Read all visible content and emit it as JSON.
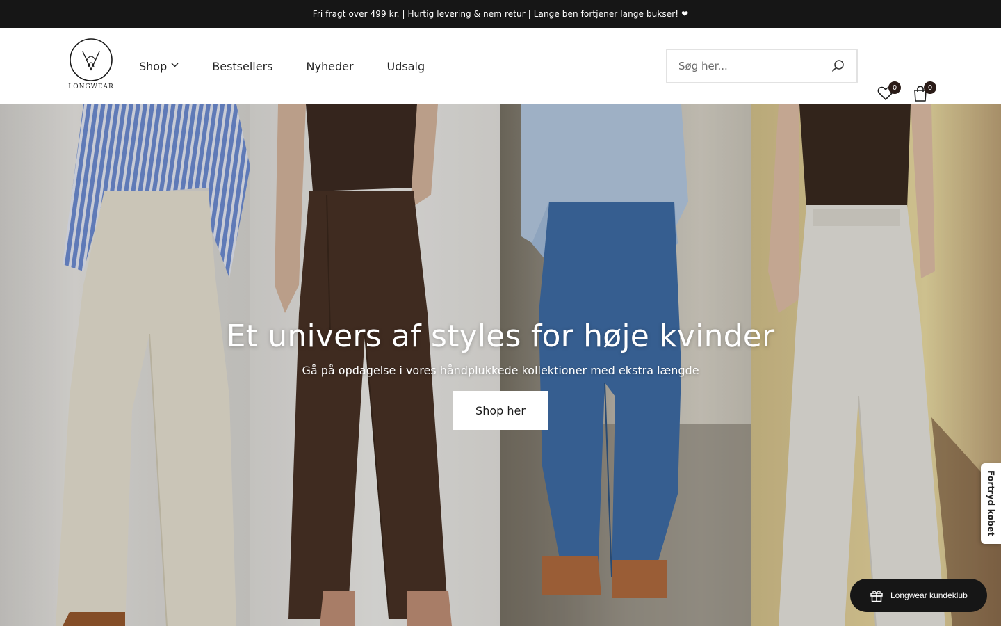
{
  "announcement": "Fri fragt over 499 kr. | Hurtig levering & nem retur | Lange ben fortjener lange bukser! ❤",
  "brand": {
    "logo_text": "LONGWEAR"
  },
  "nav": {
    "items": [
      {
        "label": "Shop",
        "has_dropdown": true
      },
      {
        "label": "Bestsellers"
      },
      {
        "label": "Nyheder"
      },
      {
        "label": "Udsalg"
      }
    ]
  },
  "search": {
    "placeholder": "Søg her...",
    "icon": "search-icon"
  },
  "header_icons": {
    "wishlist": {
      "icon": "heart-icon",
      "count": "0"
    },
    "cart": {
      "icon": "bag-icon",
      "count": "0"
    }
  },
  "hero": {
    "title": "Et univers af styles for høje kvinder",
    "subtitle": "Gå på opdagelse i vores håndplukkede kollektioner med ekstra længde",
    "button_label": "Shop her",
    "panels": [
      {
        "description": "striped blue shirt, cream wide jeans"
      },
      {
        "description": "brown tank, brown pleated trousers"
      },
      {
        "description": "light blue shirt, blue mom jeans"
      },
      {
        "description": "brown tank, cream linen pants"
      }
    ]
  },
  "side_tab": {
    "label": "Fortryd købet"
  },
  "club_widget": {
    "label": "Longwear kundeklub",
    "icon": "gift-icon"
  },
  "colors": {
    "topbar": "#161616",
    "badge": "#2a1b17",
    "accent": "#ffffff"
  }
}
